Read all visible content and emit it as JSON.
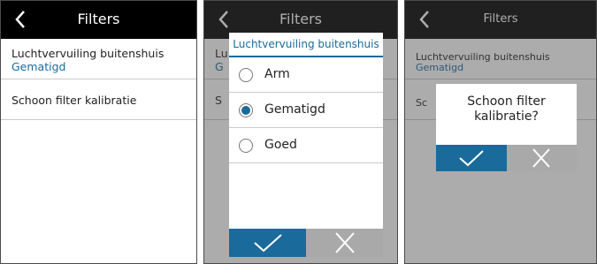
{
  "colors": {
    "accent": "#1a6a9b",
    "header": "#000000",
    "cancel": "#a9a9a9"
  },
  "panel1": {
    "title": "Filters",
    "row1_label": "Luchtvervuiling buitenshuis",
    "row1_value": "Gematigd",
    "row2_label": "Schoon filter kalibratie"
  },
  "panel2": {
    "title": "Filters",
    "bg_label_fragment": "Lu",
    "bg_value_fragment": "G",
    "bg_row2_fragment": "S",
    "dialog_title": "Luchtvervuiling buitenshuis",
    "options": [
      {
        "label": "Arm",
        "selected": false
      },
      {
        "label": "Gematigd",
        "selected": true
      },
      {
        "label": "Goed",
        "selected": false
      }
    ],
    "confirm_icon": "check-icon",
    "cancel_icon": "close-icon"
  },
  "panel3": {
    "title": "Filters",
    "row1_label": "Luchtvervuiling buitenshuis",
    "row1_value": "Gematigd",
    "row2_fragment": "Sc",
    "question_line1": "Schoon filter",
    "question_line2": "kalibratie?",
    "confirm_icon": "check-icon",
    "cancel_icon": "close-icon"
  }
}
